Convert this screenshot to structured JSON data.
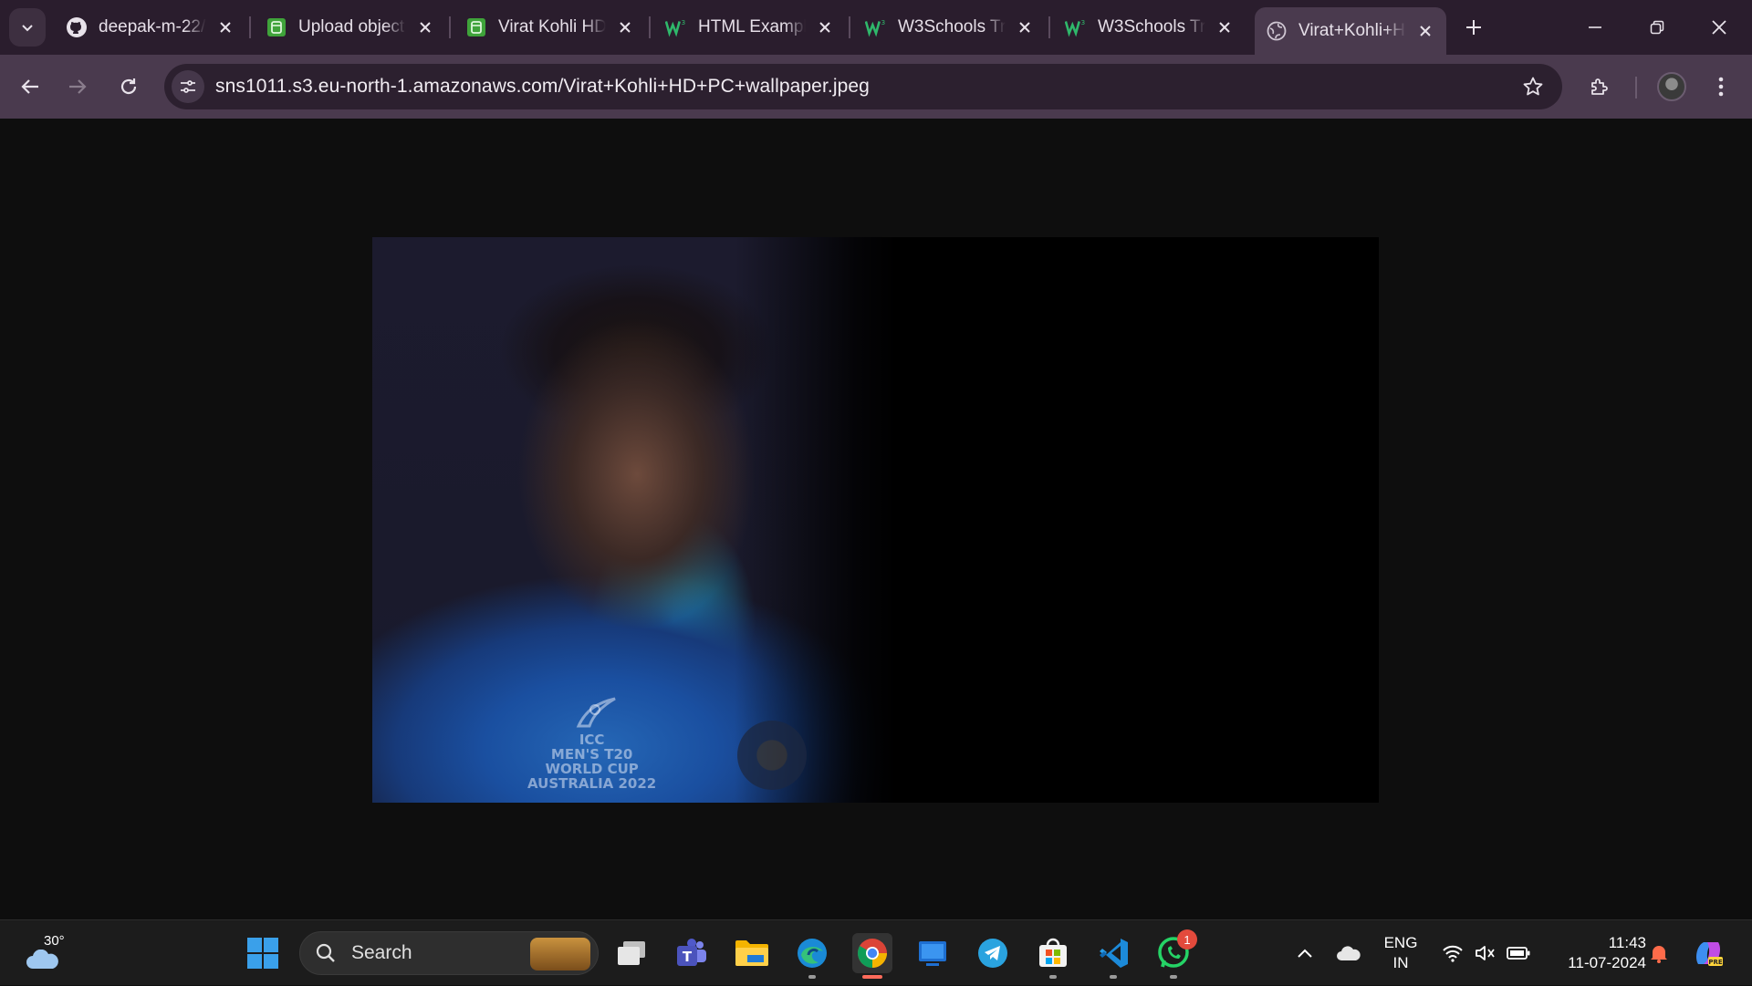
{
  "browser": {
    "tabs": [
      {
        "title": "deepak-m-22/",
        "favicon": "github-icon"
      },
      {
        "title": "Upload object",
        "favicon": "s3-bucket-icon"
      },
      {
        "title": "Virat Kohli HD",
        "favicon": "s3-bucket-icon"
      },
      {
        "title": "HTML Example",
        "favicon": "w3schools-icon"
      },
      {
        "title": "W3Schools Try",
        "favicon": "w3schools-icon"
      },
      {
        "title": "W3Schools Try",
        "favicon": "w3schools-icon"
      },
      {
        "title": "Virat+Kohli+H",
        "favicon": "globe-icon",
        "active": true
      }
    ],
    "url": "sns1011.s3.eu-north-1.amazonaws.com/Virat+Kohli+HD+PC+wallpaper.jpeg",
    "accent": "#4a3a4e"
  },
  "image_viewer": {
    "jersey_text": "ICC\nMEN'S T20\nWORLD CUP\nAUSTRALIA 2022"
  },
  "taskbar": {
    "weather_temp": "30°",
    "search_label": "Search",
    "whatsapp_badge": "1",
    "language": "ENG",
    "region": "IN",
    "time": "11:43",
    "date": "11-07-2024",
    "apps": [
      "start-icon",
      "search-icon",
      "task-view-icon",
      "teams-icon",
      "file-explorer-icon",
      "edge-icon",
      "chrome-icon",
      "windows-app-icon",
      "telegram-icon",
      "store-icon",
      "vscode-icon",
      "whatsapp-icon",
      "copilot-icon"
    ]
  }
}
